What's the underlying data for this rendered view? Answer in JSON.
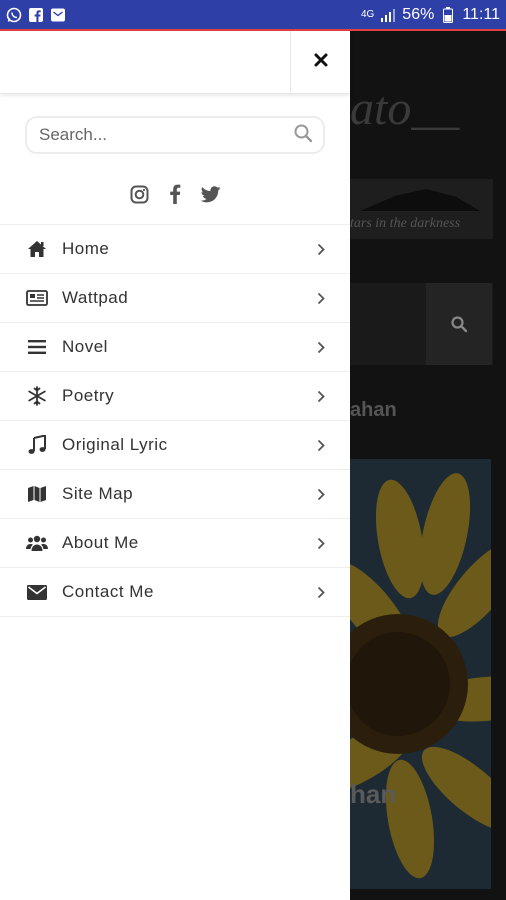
{
  "status_bar": {
    "signal_label": "4G",
    "battery_percent": "56%",
    "time": "11:11",
    "bg_color": "#2f3fa8",
    "icons": [
      "whatsapp-icon",
      "facebook-icon",
      "email-icon",
      "signal-icon",
      "battery-icon"
    ]
  },
  "background_page": {
    "title_fragment": "ato__",
    "tagline_fragment": "tars in the darkness",
    "category_fragment": "ahan",
    "caption_fragment": "han"
  },
  "drawer": {
    "close_icon": "close-icon",
    "search": {
      "placeholder": "Search..."
    },
    "social": [
      "instagram-icon",
      "facebook-icon",
      "twitter-icon"
    ],
    "menu": [
      {
        "label": "Home",
        "icon": "home-icon"
      },
      {
        "label": "Wattpad",
        "icon": "newspaper-icon"
      },
      {
        "label": "Novel",
        "icon": "list-icon"
      },
      {
        "label": "Poetry",
        "icon": "snowflake-icon"
      },
      {
        "label": "Original Lyric",
        "icon": "music-icon"
      },
      {
        "label": "Site Map",
        "icon": "map-icon"
      },
      {
        "label": "About Me",
        "icon": "users-icon"
      },
      {
        "label": "Contact Me",
        "icon": "envelope-icon"
      }
    ]
  }
}
